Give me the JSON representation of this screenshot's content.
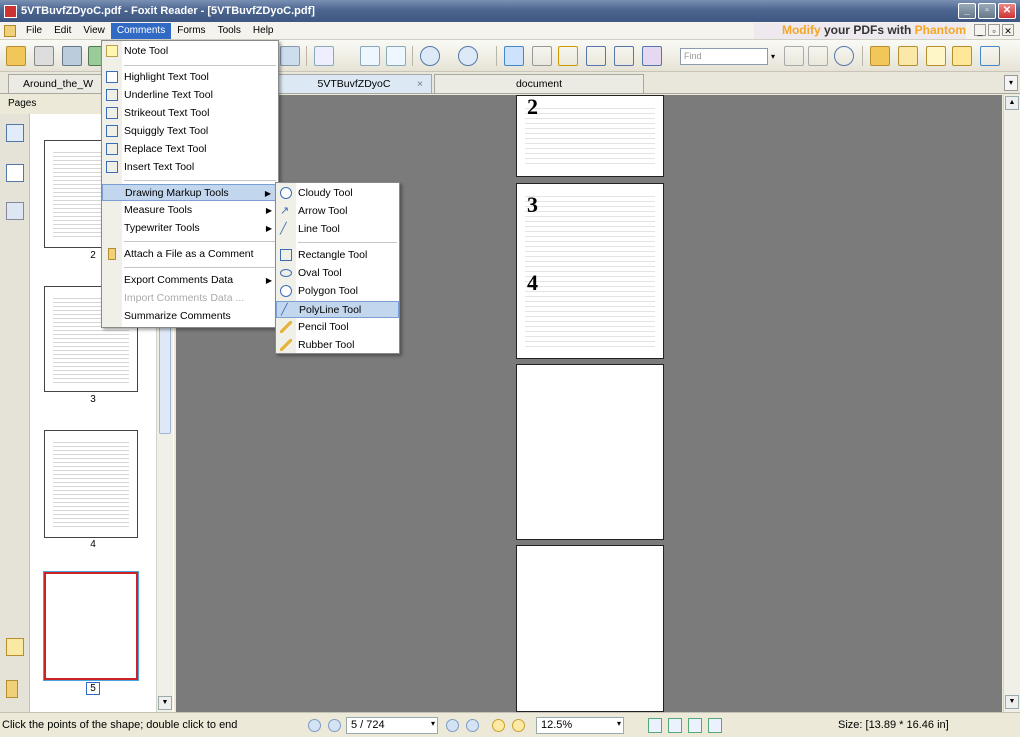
{
  "window": {
    "title": "5VTBuvfZDyoC.pdf - Foxit Reader - [5VTBuvfZDyoC.pdf]",
    "min_glyph": "_",
    "max_glyph": "▫",
    "close_glyph": "✕"
  },
  "menubar": {
    "items": [
      "File",
      "Edit",
      "View",
      "Comments",
      "Forms",
      "Tools",
      "Help"
    ],
    "ad_part1": "Modify",
    "ad_part2": " your PDFs with ",
    "ad_part3": "Phantom"
  },
  "toolbar": {
    "find_placeholder": "Find"
  },
  "tabs": {
    "items": [
      {
        "label": "Around_the_W"
      },
      {
        "label": "5VTBuvfZDyoC"
      },
      {
        "label": "document"
      }
    ],
    "close_glyph": "×",
    "scroll_glyph": "▾"
  },
  "pages_panel": {
    "header": "Pages",
    "thumbs": [
      {
        "num": "2"
      },
      {
        "num": "3"
      },
      {
        "num": "4"
      },
      {
        "num": "5"
      }
    ]
  },
  "document": {
    "pages": [
      {
        "num": "2"
      },
      {
        "num": "3"
      },
      {
        "num": "4"
      }
    ]
  },
  "comments_menu": {
    "items": [
      {
        "label": "Note Tool"
      },
      {
        "label": "Highlight Text Tool"
      },
      {
        "label": "Underline Text Tool"
      },
      {
        "label": "Strikeout Text Tool"
      },
      {
        "label": "Squiggly Text Tool"
      },
      {
        "label": "Replace Text Tool"
      },
      {
        "label": "Insert Text Tool"
      },
      {
        "label": "Drawing Markup Tools"
      },
      {
        "label": "Measure Tools"
      },
      {
        "label": "Typewriter Tools"
      },
      {
        "label": "Attach a File as a Comment"
      },
      {
        "label": "Export Comments Data"
      },
      {
        "label": "Import Comments Data ..."
      },
      {
        "label": "Summarize Comments"
      }
    ],
    "submenu_arrow": "▶"
  },
  "drawing_submenu": {
    "items": [
      {
        "label": "Cloudy Tool"
      },
      {
        "label": "Arrow Tool"
      },
      {
        "label": "Line Tool"
      },
      {
        "label": "Rectangle Tool"
      },
      {
        "label": "Oval Tool"
      },
      {
        "label": "Polygon Tool"
      },
      {
        "label": "PolyLine Tool"
      },
      {
        "label": "Pencil Tool"
      },
      {
        "label": "Rubber Tool"
      }
    ]
  },
  "statusbar": {
    "message": "Click the points of the shape; double click to end",
    "page_value": "5 / 724",
    "zoom_value": "12.5%",
    "size": "Size: [13.89 * 16.46 in]",
    "dd_glyph": "▾"
  },
  "colors": {
    "menu_highlight": "#316ac5",
    "hover_item": "#c2d6ee",
    "doc_background": "#7b7b7b",
    "selected_thumb_border": "#cc2222"
  }
}
